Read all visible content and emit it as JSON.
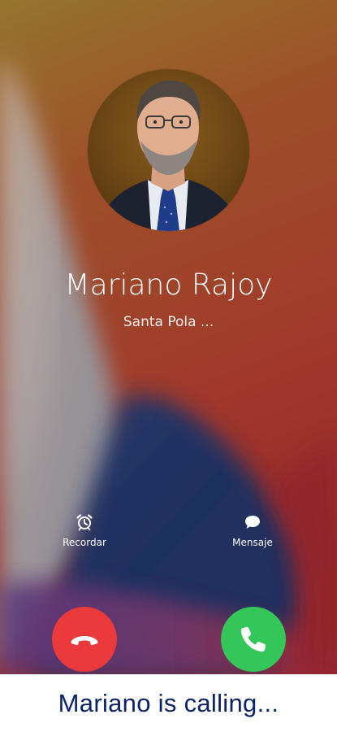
{
  "call": {
    "caller_name": "Mariano Rajoy",
    "location": "Santa Pola ...",
    "actions": {
      "remind_label": "Recordar",
      "message_label": "Mensaje"
    },
    "buttons": {
      "decline_icon": "phone-hangup-icon",
      "accept_icon": "phone-icon"
    }
  },
  "caption": {
    "text": "Mariano is calling..."
  },
  "colors": {
    "decline": "#ea3a3c",
    "accept": "#35c659",
    "caption_text": "#0b2269"
  }
}
